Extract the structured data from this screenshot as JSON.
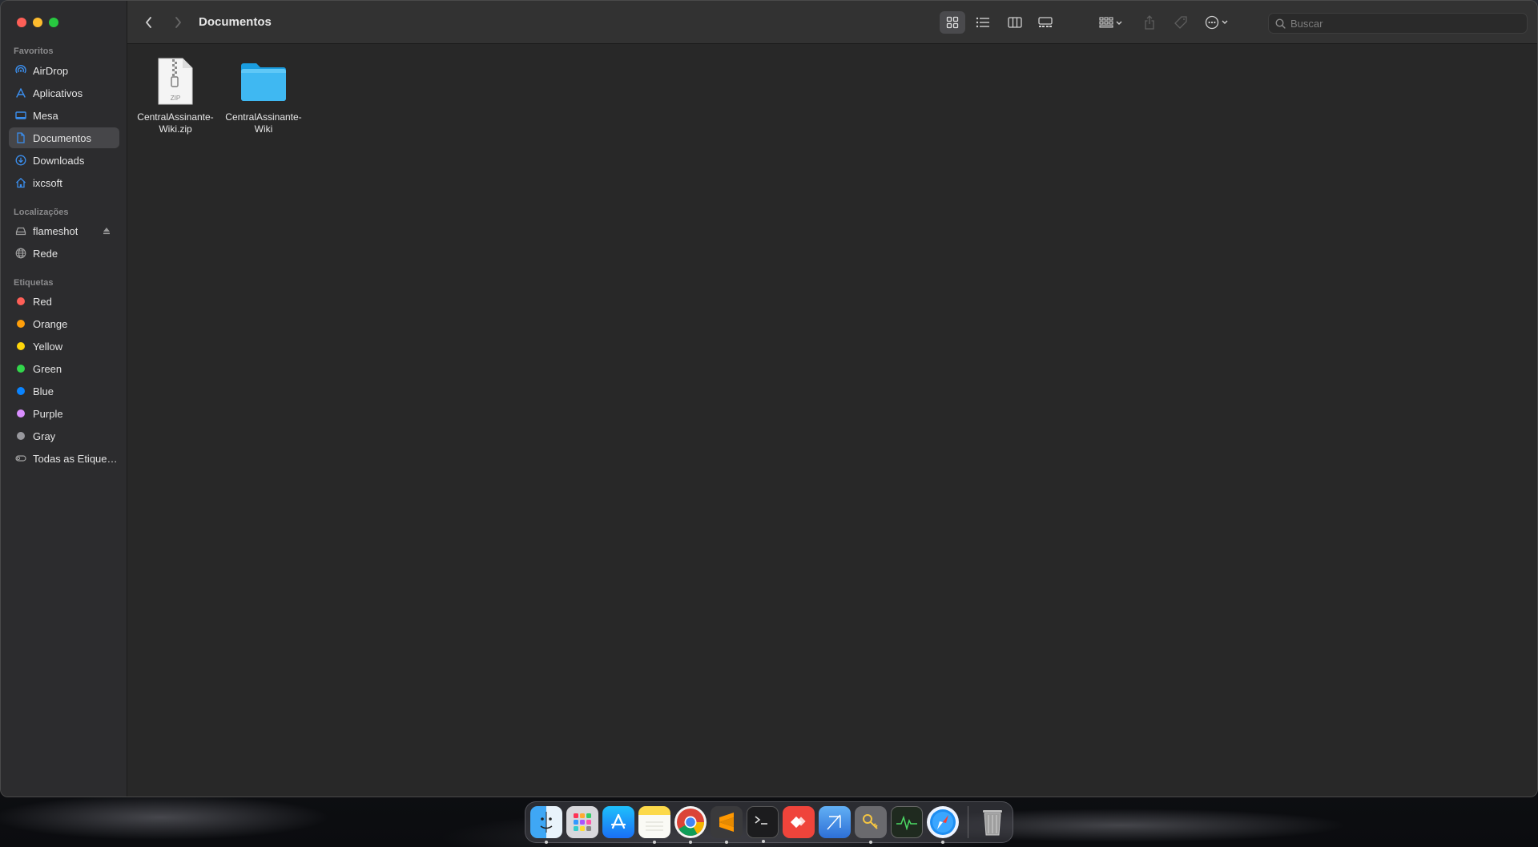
{
  "window": {
    "title": "Documentos"
  },
  "sidebar": {
    "favorites_title": "Favoritos",
    "favorites": [
      {
        "label": "AirDrop",
        "icon": "airdrop-icon"
      },
      {
        "label": "Aplicativos",
        "icon": "applications-icon"
      },
      {
        "label": "Mesa",
        "icon": "desktop-icon"
      },
      {
        "label": "Documentos",
        "icon": "document-icon",
        "selected": true
      },
      {
        "label": "Downloads",
        "icon": "downloads-icon"
      },
      {
        "label": "ixcsoft",
        "icon": "home-icon"
      }
    ],
    "locations_title": "Localizações",
    "locations": [
      {
        "label": "flameshot",
        "icon": "drive-icon",
        "eject": true
      },
      {
        "label": "Rede",
        "icon": "network-icon"
      }
    ],
    "tags_title": "Etiquetas",
    "tags": [
      {
        "label": "Red",
        "color": "#fe5f57"
      },
      {
        "label": "Orange",
        "color": "#ff9f0a"
      },
      {
        "label": "Yellow",
        "color": "#ffd60a"
      },
      {
        "label": "Green",
        "color": "#32d74b"
      },
      {
        "label": "Blue",
        "color": "#0a84ff"
      },
      {
        "label": "Purple",
        "color": "#da8fff"
      },
      {
        "label": "Gray",
        "color": "#98989d"
      },
      {
        "label": "Todas as Etiquetas…",
        "icon": "all-tags-icon"
      }
    ]
  },
  "toolbar": {
    "search_placeholder": "Buscar",
    "view_mode": "icons"
  },
  "files": [
    {
      "name": "CentralAssinante-Wiki.zip",
      "type": "zip",
      "badge": "ZIP"
    },
    {
      "name": "CentralAssinante-Wiki",
      "type": "folder"
    }
  ],
  "dock": {
    "apps": [
      {
        "name": "finder",
        "running": true
      },
      {
        "name": "launchpad",
        "running": false
      },
      {
        "name": "app-store",
        "running": false
      },
      {
        "name": "notes",
        "running": true
      },
      {
        "name": "chrome",
        "running": true
      },
      {
        "name": "sublime-text",
        "running": true
      },
      {
        "name": "terminal",
        "running": true
      },
      {
        "name": "anydesk",
        "running": false
      },
      {
        "name": "xcode-instruments",
        "running": false
      },
      {
        "name": "keychain-access",
        "running": true
      },
      {
        "name": "activity-monitor",
        "running": false
      },
      {
        "name": "safari",
        "running": true
      }
    ],
    "trash": {
      "name": "trash"
    }
  }
}
